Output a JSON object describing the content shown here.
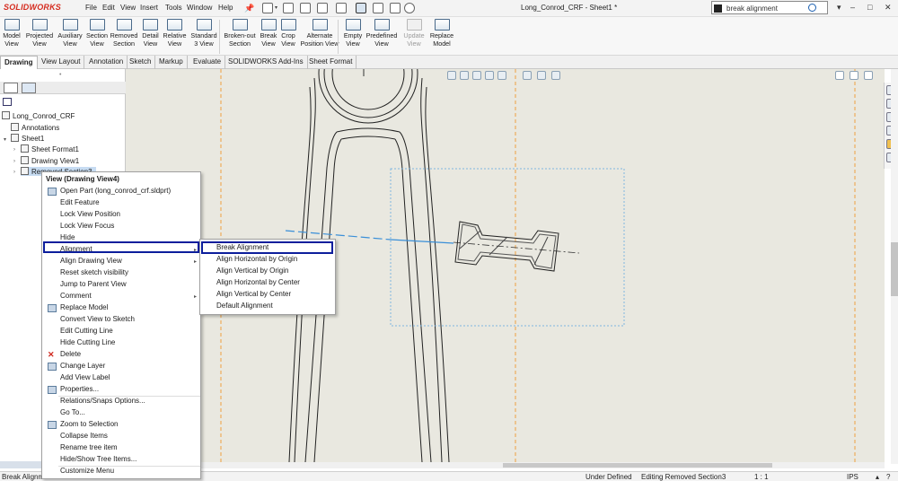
{
  "app": {
    "logo": "SOLIDWORKS",
    "doc_title": "Long_Conrod_CRF - Sheet1 *"
  },
  "menubar": [
    "File",
    "Edit",
    "View",
    "Insert",
    "Tools",
    "Window",
    "Help"
  ],
  "search": {
    "value": "break alignment"
  },
  "window_controls": [
    "–",
    "□",
    "✕"
  ],
  "ribbon": [
    {
      "label": "Model\nView",
      "enabled": true
    },
    {
      "label": "Projected\nView",
      "enabled": true
    },
    {
      "label": "Auxiliary\nView",
      "enabled": true
    },
    {
      "label": "Section\nView",
      "enabled": true
    },
    {
      "label": "Removed\nSection",
      "enabled": true
    },
    {
      "label": "Detail\nView",
      "enabled": true
    },
    {
      "label": "Relative\nView",
      "enabled": true
    },
    {
      "label": "Standard\n3 View",
      "enabled": true
    },
    {
      "label": "Broken-out\nSection",
      "enabled": true
    },
    {
      "label": "Break\nView",
      "enabled": true
    },
    {
      "label": "Crop\nView",
      "enabled": true
    },
    {
      "label": "Alternate\nPosition View",
      "enabled": true
    },
    {
      "label": "Empty\nView",
      "enabled": true
    },
    {
      "label": "Predefined\nView",
      "enabled": true
    },
    {
      "label": "Update\nView",
      "enabled": false
    },
    {
      "label": "Replace\nModel",
      "enabled": true
    }
  ],
  "tabs": [
    "Drawing",
    "View Layout",
    "Annotation",
    "Sketch",
    "Markup",
    "Evaluate",
    "SOLIDWORKS Add-Ins",
    "Sheet Format"
  ],
  "active_tab": "Drawing",
  "tree": {
    "root": "Long_Conrod_CRF",
    "items": [
      "Annotations",
      "Sheet1",
      "Sheet Format1",
      "Drawing View1",
      "Removed Section3"
    ]
  },
  "context_menu": {
    "header": "View (Drawing View4)",
    "items": [
      {
        "label": "Open Part (long_conrod_crf.sldprt)",
        "icon": "open-part-icon"
      },
      {
        "label": "Edit Feature"
      },
      {
        "label": "Lock View Position"
      },
      {
        "label": "Lock View Focus"
      },
      {
        "label": "Hide"
      },
      {
        "label": "Alignment",
        "submenu": true,
        "highlighted": true
      },
      {
        "label": "Align Drawing View",
        "submenu": true
      },
      {
        "label": "Reset sketch visibility"
      },
      {
        "label": "Jump to Parent View"
      },
      {
        "label": "Comment",
        "submenu": true
      },
      {
        "label": "Replace Model",
        "icon": "replace-model-icon"
      },
      {
        "label": "Convert View to Sketch"
      },
      {
        "label": "Edit Cutting Line"
      },
      {
        "label": "Hide Cutting Line"
      },
      {
        "label": "Delete",
        "icon": "delete-icon",
        "icon_color": "#d0281e"
      },
      {
        "label": "Change Layer",
        "icon": "layer-icon"
      },
      {
        "label": "Add View Label"
      },
      {
        "label": "Properties...",
        "icon": "properties-icon"
      },
      {
        "label": "Relations/Snaps Options...",
        "sep_before": true
      },
      {
        "label": "Go To..."
      },
      {
        "label": "Zoom to Selection",
        "icon": "zoom-icon"
      },
      {
        "label": "Collapse Items"
      },
      {
        "label": "Rename tree item"
      },
      {
        "label": "Hide/Show Tree Items..."
      },
      {
        "label": "Customize Menu",
        "sep_before": true
      }
    ]
  },
  "submenu": {
    "items": [
      "Break Alignment",
      "Align Horizontal by Origin",
      "Align Vertical by Origin",
      "Align Horizontal by Center",
      "Align Vertical by Center",
      "Default Alignment"
    ],
    "highlighted": "Break Alignment"
  },
  "status": {
    "hint": "Break Alignme",
    "constraint": "Under Defined",
    "editing": "Editing Removed Section3",
    "scale": "1 : 1",
    "units": "IPS"
  },
  "colors": {
    "highlight_border": "#0c1e9c",
    "logo_red": "#d52b1e",
    "canvas_bg": "#e9e8e0",
    "alignment_line": "#3a8fd8"
  }
}
